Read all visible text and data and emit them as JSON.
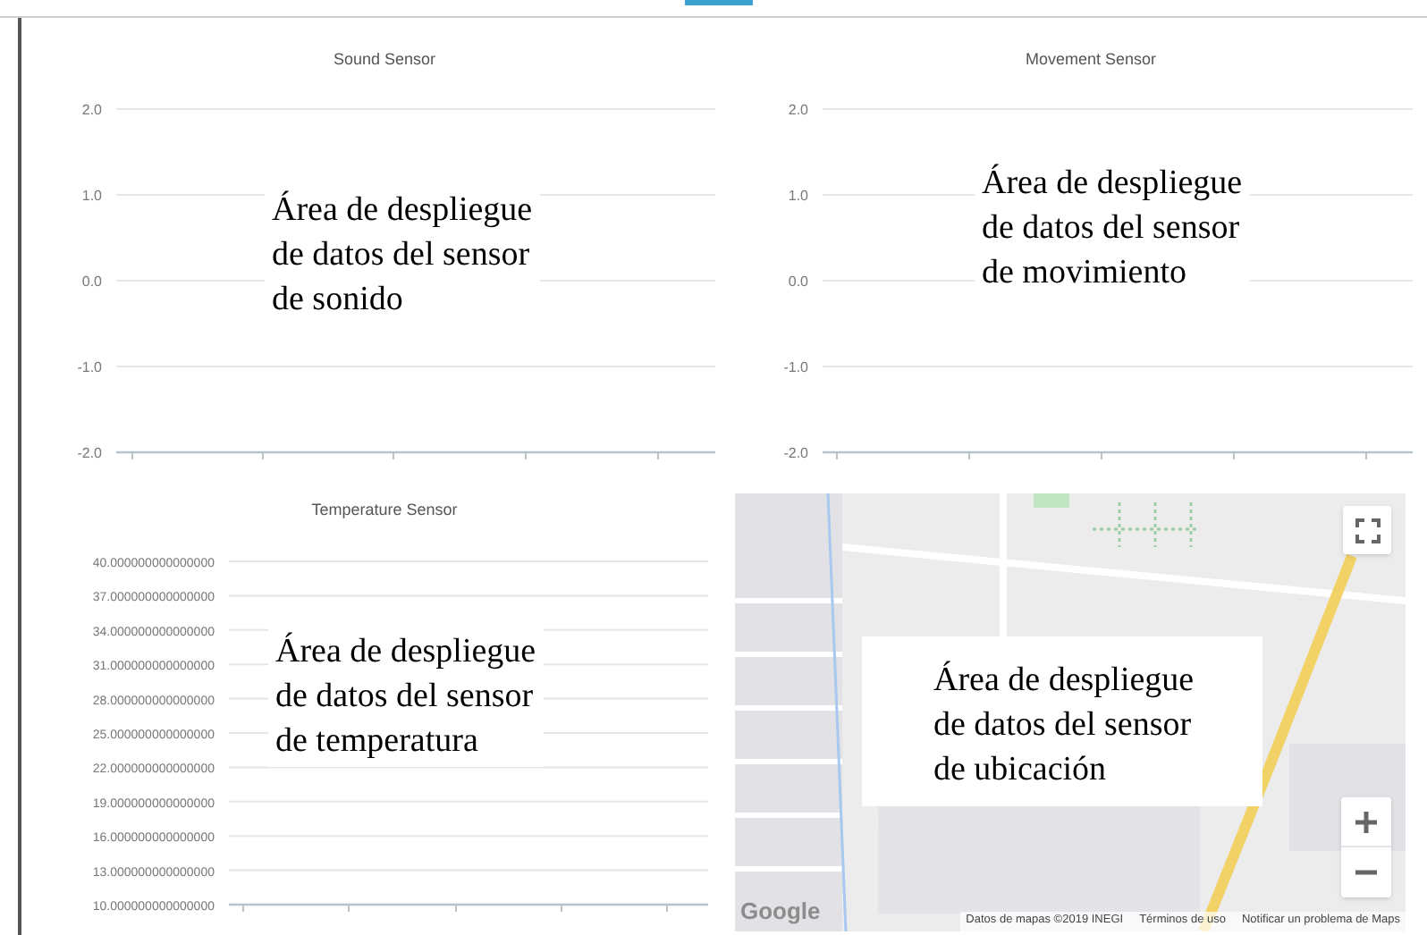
{
  "charts": [
    {
      "kind": "line_chart",
      "title": "Sound Sensor",
      "y_tick_labels": [
        "2.0",
        "1.0",
        "0.0",
        "-1.0",
        "-2.0"
      ],
      "annotation": "Área de despliegue\nde datos del sensor\nde sonido"
    },
    {
      "kind": "line_chart",
      "title": "Movement Sensor",
      "y_tick_labels": [
        "2.0",
        "1.0",
        "0.0",
        "-1.0",
        "-2.0"
      ],
      "annotation": "Área de despliegue\nde datos del sensor\nde movimiento"
    },
    {
      "kind": "line_chart",
      "title": "Temperature Sensor",
      "y_tick_labels": [
        "40.000000000000000",
        "37.000000000000000",
        "34.000000000000000",
        "31.000000000000000",
        "28.000000000000000",
        "25.000000000000000",
        "22.000000000000000",
        "19.000000000000000",
        "16.000000000000000",
        "13.000000000000000",
        "10.000000000000000"
      ],
      "annotation": "Área de despliegue\nde datos del sensor\nde temperatura"
    }
  ],
  "map": {
    "kind": "picture",
    "annotation": "Área de despliegue\nde datos del sensor\nde ubicación",
    "logo": "Google",
    "attribution": [
      "Datos de mapas ©2019 INEGI",
      "Términos de uso",
      "Notificar un problema de Maps"
    ]
  }
}
